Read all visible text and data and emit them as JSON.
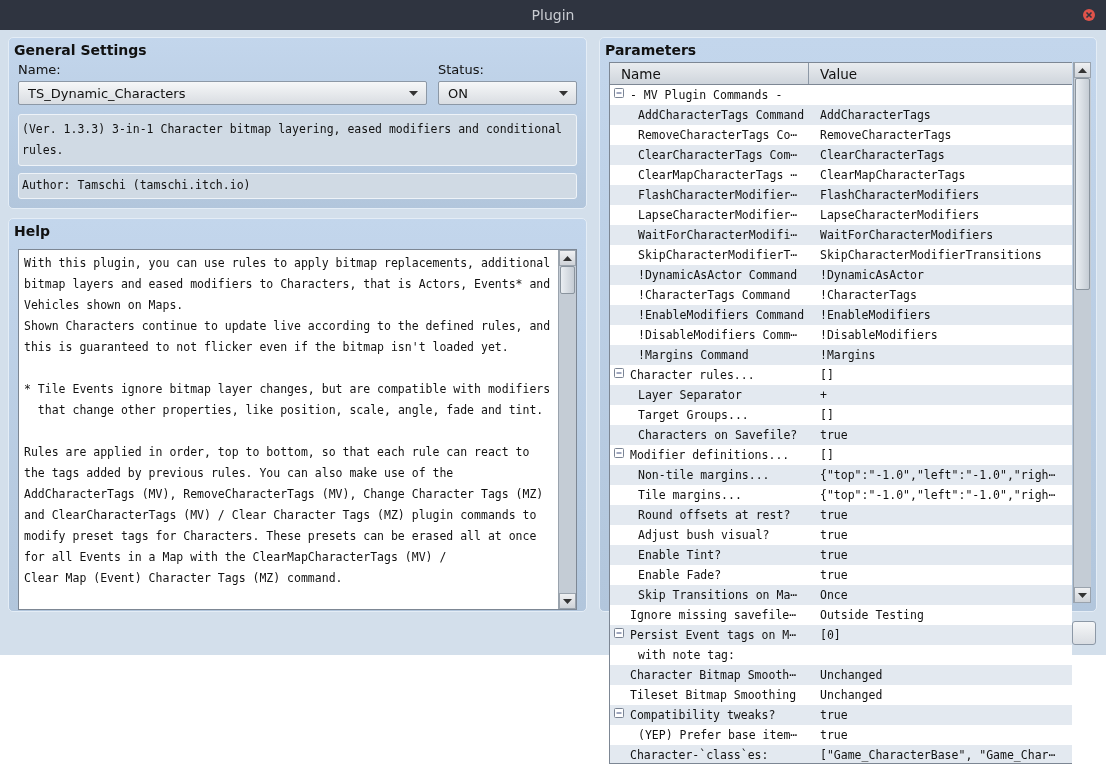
{
  "window": {
    "title": "Plugin"
  },
  "general_settings": {
    "title": "General Settings",
    "name_label": "Name:",
    "name_value": "TS_Dynamic_Characters",
    "status_label": "Status:",
    "status_value": "ON",
    "description": "(Ver. 1.3.3) 3-in-1 Character bitmap layering, eased modifiers and conditional\nrules.",
    "author": "Author: Tamschi (tamschi.itch.io)"
  },
  "help": {
    "title": "Help",
    "text": "With this plugin, you can use rules to apply bitmap replacements, additional\nbitmap layers and eased modifiers to Characters, that is Actors, Events* and\nVehicles shown on Maps.\nShown Characters continue to update live according to the defined rules, and\nthis is guaranteed to not flicker even if the bitmap isn't loaded yet.\n\n* Tile Events ignore bitmap layer changes, but are compatible with modifiers\n  that change other properties, like position, scale, angle, fade and tint.\n\nRules are applied in order, top to bottom, so that each rule can react to\nthe tags added by previous rules. You can also make use of the\nAddCharacterTags (MV), RemoveCharacterTags (MV), Change Character Tags (MZ)\nand ClearCharacterTags (MV) / Clear Character Tags (MZ) plugin commands to\nmodify preset tags for Characters. These presets can be erased all at once\nfor all Events in a Map with the ClearMapCharacterTags (MV) /\nClear Map (Event) Character Tags (MZ) command."
  },
  "parameters": {
    "title": "Parameters",
    "columns": [
      "Name",
      "Value"
    ],
    "rows": [
      {
        "name": "- MV Plugin Commands -",
        "expanded": true,
        "children": [
          {
            "name": "AddCharacterTags Command",
            "value": "AddCharacterTags"
          },
          {
            "name": "RemoveCharacterTags Co⋯",
            "value": "RemoveCharacterTags"
          },
          {
            "name": "ClearCharacterTags Com⋯",
            "value": "ClearCharacterTags"
          },
          {
            "name": "ClearMapCharacterTags ⋯",
            "value": "ClearMapCharacterTags"
          },
          {
            "name": "FlashCharacterModifier⋯",
            "value": "FlashCharacterModifiers"
          },
          {
            "name": "LapseCharacterModifier⋯",
            "value": "LapseCharacterModifiers"
          },
          {
            "name": "WaitForCharacterModifi⋯",
            "value": "WaitForCharacterModifiers"
          },
          {
            "name": "SkipCharacterModifierT⋯",
            "value": "SkipCharacterModifierTransitions"
          },
          {
            "name": "!DynamicAsActor Command",
            "value": "!DynamicAsActor"
          },
          {
            "name": "!CharacterTags Command",
            "value": "!CharacterTags"
          },
          {
            "name": "!EnableModifiers Command",
            "value": "!EnableModifiers"
          },
          {
            "name": "!DisableModifiers Comm⋯",
            "value": "!DisableModifiers"
          },
          {
            "name": "!Margins Command",
            "value": "!Margins"
          }
        ]
      },
      {
        "name": "Character rules...",
        "value": "[]",
        "expanded": true,
        "children": [
          {
            "name": "Layer Separator",
            "value": "+"
          },
          {
            "name": "Target Groups...",
            "value": "[]"
          },
          {
            "name": "Characters on Savefile?",
            "value": "true"
          }
        ]
      },
      {
        "name": "Modifier definitions...",
        "value": "[]",
        "expanded": true,
        "children": [
          {
            "name": "Non-tile margins...",
            "value": "{\"top\":\"-1.0\",\"left\":\"-1.0\",\"righ⋯"
          },
          {
            "name": "Tile margins...",
            "value": "{\"top\":\"-1.0\",\"left\":\"-1.0\",\"righ⋯"
          },
          {
            "name": "Round offsets at rest?",
            "value": "true"
          },
          {
            "name": "Adjust bush visual?",
            "value": "true"
          },
          {
            "name": "Enable Tint?",
            "value": "true"
          },
          {
            "name": "Enable Fade?",
            "value": "true"
          },
          {
            "name": "Skip Transitions on Ma⋯",
            "value": "Once"
          }
        ]
      },
      {
        "name": "Ignore missing savefile⋯",
        "value": "Outside Testing"
      },
      {
        "name": "Persist Event tags on M⋯",
        "value": "[0]",
        "expanded": true,
        "children": [
          {
            "name": "with note tag:"
          }
        ]
      },
      {
        "name": "Character Bitmap Smooth⋯",
        "value": "Unchanged"
      },
      {
        "name": "Tileset Bitmap Smoothing",
        "value": "Unchanged"
      },
      {
        "name": "Compatibility tweaks?",
        "value": "true",
        "expanded": true,
        "children": [
          {
            "name": "(YEP) Prefer base item⋯",
            "value": "true"
          }
        ]
      },
      {
        "name": "Character-`class`es:",
        "value": "[\"Game_CharacterBase\", \"Game_Char⋯"
      }
    ]
  }
}
